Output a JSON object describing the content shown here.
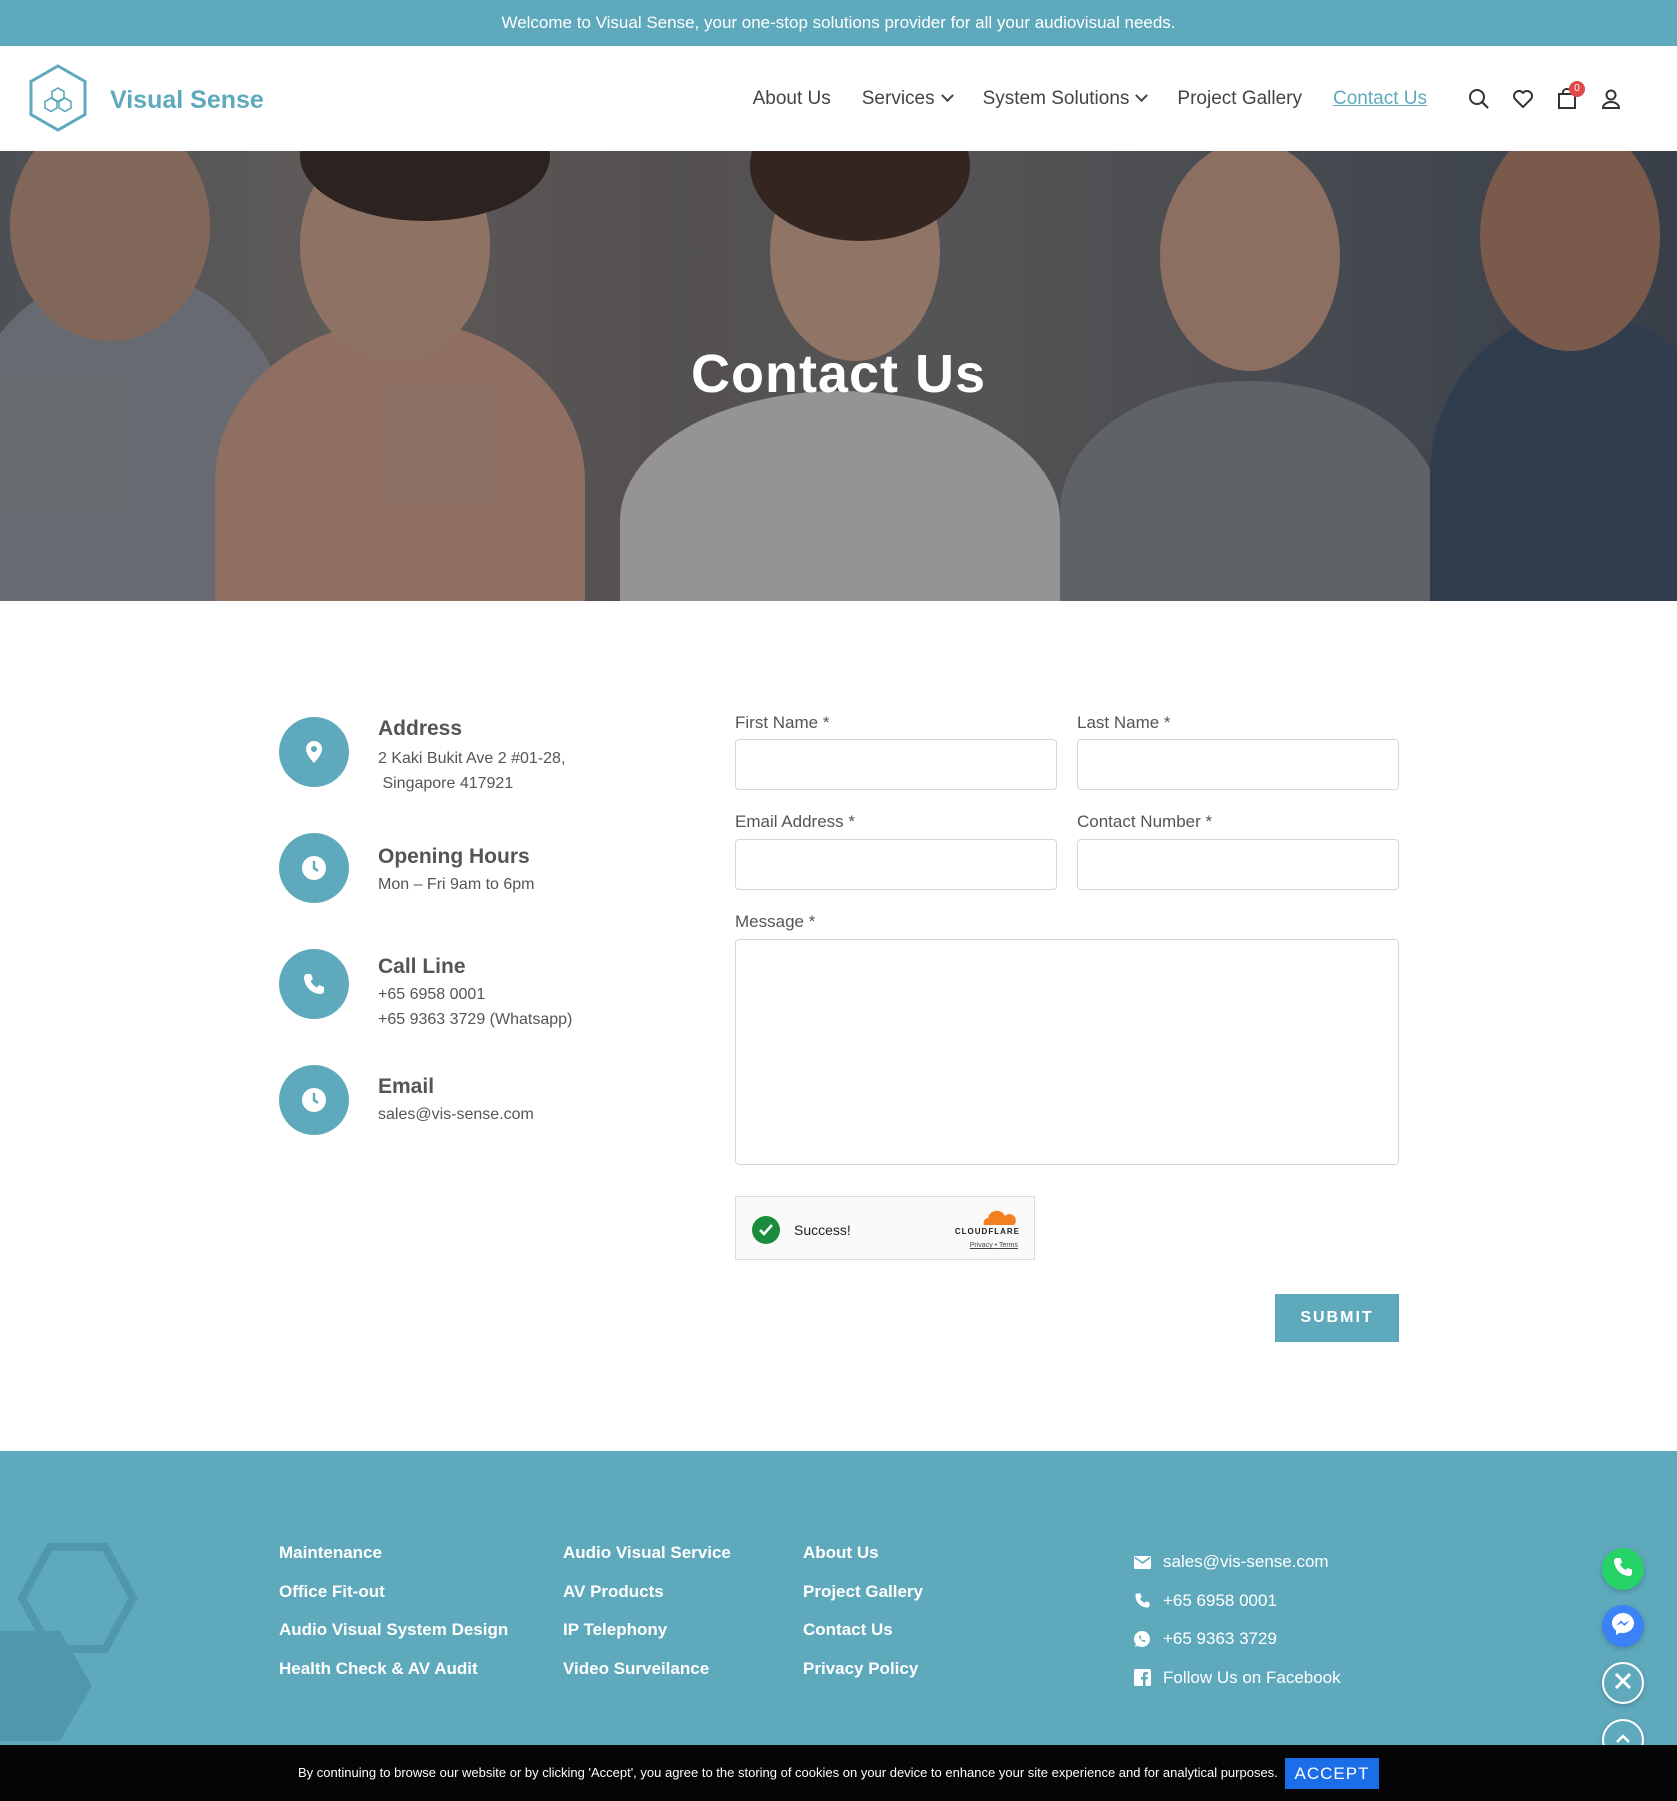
{
  "announcement": "Welcome to Visual Sense, your one-stop solutions provider for all your audiovisual needs.",
  "brand": {
    "name": "Visual Sense",
    "logo_icon": "hexagon-cube-logo-icon"
  },
  "nav": {
    "items": [
      {
        "label": "About Us",
        "has_dropdown": false,
        "active": false
      },
      {
        "label": "Services",
        "has_dropdown": true,
        "active": false
      },
      {
        "label": "System Solutions",
        "has_dropdown": true,
        "active": false
      },
      {
        "label": "Project Gallery",
        "has_dropdown": false,
        "active": false
      },
      {
        "label": "Contact Us",
        "has_dropdown": false,
        "active": true
      }
    ],
    "cart_count": "0"
  },
  "hero": {
    "title": "Contact Us"
  },
  "contact_info": {
    "address": {
      "title": "Address",
      "line1": "2 Kaki Bukit Ave 2 #01-28,",
      "line2": " Singapore 417921",
      "icon": "map-pin-icon"
    },
    "hours": {
      "title": "Opening Hours",
      "line1": "Mon – Fri 9am to 6pm",
      "icon": "clock-icon"
    },
    "call": {
      "title": "Call Line",
      "line1": "+65 6958 0001",
      "line2": "+65 9363 3729 (Whatsapp)",
      "icon": "phone-icon"
    },
    "email": {
      "title": "Email",
      "line1": "sales@vis-sense.com",
      "icon": "clock-icon"
    }
  },
  "form": {
    "first_name": {
      "label": "First Name  *",
      "value": ""
    },
    "last_name": {
      "label": "Last Name  *",
      "value": ""
    },
    "email": {
      "label": "Email Address  *",
      "value": ""
    },
    "contact_number": {
      "label": "Contact Number  *",
      "value": ""
    },
    "message": {
      "label": "Message  *",
      "value": ""
    },
    "captcha": {
      "status": "Success!",
      "brand": "CLOUDFLARE",
      "privacy": "Privacy",
      "separator": "•",
      "terms": "Terms"
    },
    "submit": "SUBMIT"
  },
  "footer": {
    "col1": [
      "Maintenance",
      "Office Fit-out",
      "Audio Visual System Design",
      "Health Check & AV Audit"
    ],
    "col2": [
      "Audio Visual Service",
      "AV Products",
      "IP Telephony",
      "Video Surveilance"
    ],
    "col3": [
      "About Us",
      "Project Gallery",
      "Contact Us",
      "Privacy Policy"
    ],
    "contact": {
      "email": "sales@vis-sense.com",
      "phone": "+65 6958 0001",
      "whatsapp": "+65 9363 3729",
      "facebook": "Follow Us on Facebook"
    }
  },
  "cookie": {
    "text": "By continuing to browse our website or by clicking 'Accept', you agree to the storing of cookies on your device to enhance your site experience and for analytical purposes.",
    "accept": "ACCEPT"
  },
  "colors": {
    "brand": "#5fa9bd",
    "whatsapp": "#25d366",
    "messenger": "#3b82f6",
    "accept": "#1b6ee8"
  }
}
